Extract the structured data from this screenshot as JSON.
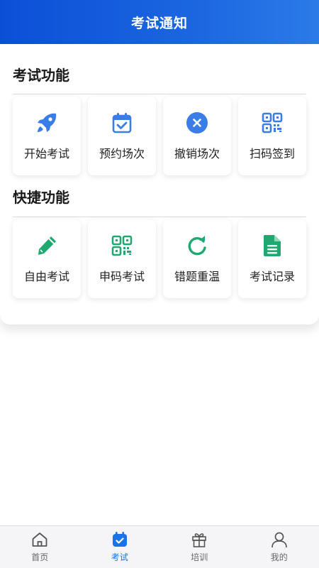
{
  "header": {
    "title": "考试通知"
  },
  "sections": [
    {
      "title": "考试功能",
      "items": [
        {
          "label": "开始考试",
          "icon": "rocket-icon"
        },
        {
          "label": "预约场次",
          "icon": "calendar-check-icon"
        },
        {
          "label": "撤销场次",
          "icon": "cancel-circle-icon"
        },
        {
          "label": "扫码签到",
          "icon": "qr-code-icon"
        }
      ]
    },
    {
      "title": "快捷功能",
      "items": [
        {
          "label": "自由考试",
          "icon": "pencil-icon"
        },
        {
          "label": "申码考试",
          "icon": "qr-code-icon"
        },
        {
          "label": "错题重温",
          "icon": "refresh-icon"
        },
        {
          "label": "考试记录",
          "icon": "document-icon"
        }
      ]
    }
  ],
  "tabbar": {
    "items": [
      {
        "label": "首页",
        "icon": "home-icon",
        "active": false
      },
      {
        "label": "考试",
        "icon": "exam-calendar-icon",
        "active": true
      },
      {
        "label": "培训",
        "icon": "gift-icon",
        "active": false
      },
      {
        "label": "我的",
        "icon": "user-icon",
        "active": false
      }
    ]
  },
  "colors": {
    "header_start": "#0b4fd6",
    "header_end": "#2b7be8",
    "icon_blue": "#3a7de8",
    "icon_green": "#1fa971",
    "tab_active": "#1a73e8",
    "tab_inactive": "#666666"
  }
}
